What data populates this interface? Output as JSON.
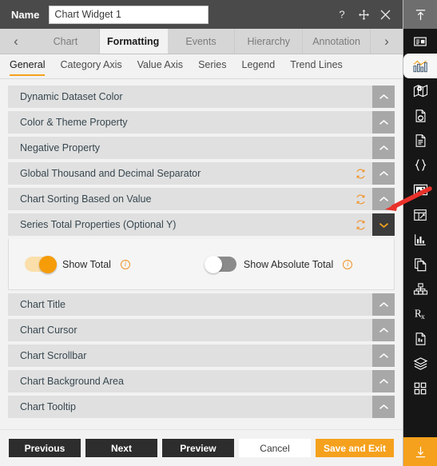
{
  "titlebar": {
    "name_label": "Name",
    "widget_name": "Chart Widget 1",
    "name_placeholder": "Chart Widget 1",
    "help_icon": "question-mark-icon",
    "move_icon": "move-icon",
    "close_icon": "close-icon"
  },
  "tabstrip": {
    "prev_arrow": "‹",
    "next_arrow": "›",
    "tabs": [
      {
        "label": "Chart",
        "active": false
      },
      {
        "label": "Formatting",
        "active": true
      },
      {
        "label": "Events",
        "active": false
      },
      {
        "label": "Hierarchy",
        "active": false
      },
      {
        "label": "Annotation",
        "active": false
      }
    ]
  },
  "subtabs": [
    {
      "label": "General",
      "active": true
    },
    {
      "label": "Category Axis",
      "active": false
    },
    {
      "label": "Value Axis",
      "active": false
    },
    {
      "label": "Series",
      "active": false
    },
    {
      "label": "Legend",
      "active": false
    },
    {
      "label": "Trend Lines",
      "active": false
    }
  ],
  "accordion": [
    {
      "label": "Dynamic Dataset Color",
      "reset": false,
      "open": false
    },
    {
      "label": "Color & Theme Property",
      "reset": false,
      "open": false
    },
    {
      "label": "Negative Property",
      "reset": false,
      "open": false
    },
    {
      "label": "Global Thousand and Decimal Separator",
      "reset": true,
      "open": false
    },
    {
      "label": "Chart Sorting Based on Value",
      "reset": true,
      "open": false
    },
    {
      "label": "Series Total Properties (Optional Y)",
      "reset": true,
      "open": true
    },
    {
      "label": "Chart Title",
      "reset": false,
      "open": false
    },
    {
      "label": "Chart Cursor",
      "reset": false,
      "open": false
    },
    {
      "label": "Chart Scrollbar",
      "reset": false,
      "open": false
    },
    {
      "label": "Chart Background Area",
      "reset": false,
      "open": false
    },
    {
      "label": "Chart Tooltip",
      "reset": false,
      "open": false
    }
  ],
  "series_total_panel": {
    "show_total": {
      "label": "Show Total",
      "state": "on",
      "info_icon": "info-icon"
    },
    "show_absolute_total": {
      "label": "Show Absolute Total",
      "state": "off",
      "info_icon": "info-icon"
    }
  },
  "footer": {
    "previous": "Previous",
    "next": "Next",
    "preview": "Preview",
    "cancel": "Cancel",
    "save_and_exit": "Save and Exit"
  },
  "sidebar": [
    {
      "name": "collapse-up-icon"
    },
    {
      "name": "layout-panel-icon"
    },
    {
      "name": "chart-icon"
    },
    {
      "name": "map-icon"
    },
    {
      "name": "document-refresh-icon"
    },
    {
      "name": "document-icon"
    },
    {
      "name": "code-braces-icon"
    },
    {
      "name": "image-icon"
    },
    {
      "name": "form-widget-icon"
    },
    {
      "name": "bar-chart-icon"
    },
    {
      "name": "copy-document-icon"
    },
    {
      "name": "hierarchy-icon"
    },
    {
      "name": "prescription-rx-icon"
    },
    {
      "name": "report-document-icon"
    },
    {
      "name": "layers-icon"
    },
    {
      "name": "grid-apps-icon"
    },
    {
      "name": "download-icon"
    }
  ],
  "colors": {
    "accent": "#f5a11d",
    "titlebar_bg": "#4a4a4a",
    "panel_bg": "#f2f2f2",
    "accordion_bg": "#e0e0e0",
    "toggle_btn_bg": "#a8a8a8",
    "toggle_open_bg": "#3b3b3b",
    "sidebar_bg": "#161616",
    "annotation_arrow": "#e8312a"
  }
}
